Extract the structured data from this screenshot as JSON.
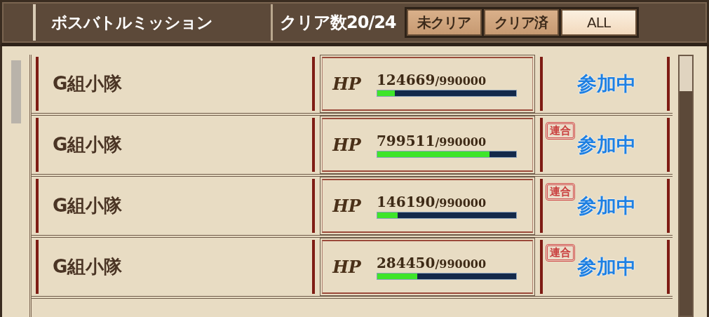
{
  "header": {
    "title": "ボスバトルミッション",
    "clear_count": "クリア数20/24",
    "filters": [
      {
        "label": "未クリア",
        "selected": false
      },
      {
        "label": "クリア済",
        "selected": false
      },
      {
        "label": "ALL",
        "selected": true
      }
    ]
  },
  "rows": [
    {
      "name": "G組小隊",
      "hp_label": "HP",
      "hp_current": "124669",
      "hp_max": "/990000",
      "level": 0.126,
      "status": "参加中"
    },
    {
      "name": "G組小隊",
      "hp_label": "HP",
      "hp_current": "799511",
      "hp_max": "/990000",
      "level": 0.808,
      "stamp": "連合",
      "status": "参加中"
    },
    {
      "name": "G組小隊",
      "hp_label": "HP",
      "hp_current": "146190",
      "hp_max": "/990000",
      "level": 0.148,
      "stamp": "連合",
      "status": "参加中"
    },
    {
      "name": "G組小隊",
      "hp_label": "HP",
      "hp_current": "284450",
      "hp_max": "/990000",
      "level": 0.287,
      "stamp": "連合",
      "status": "参加中"
    }
  ]
}
